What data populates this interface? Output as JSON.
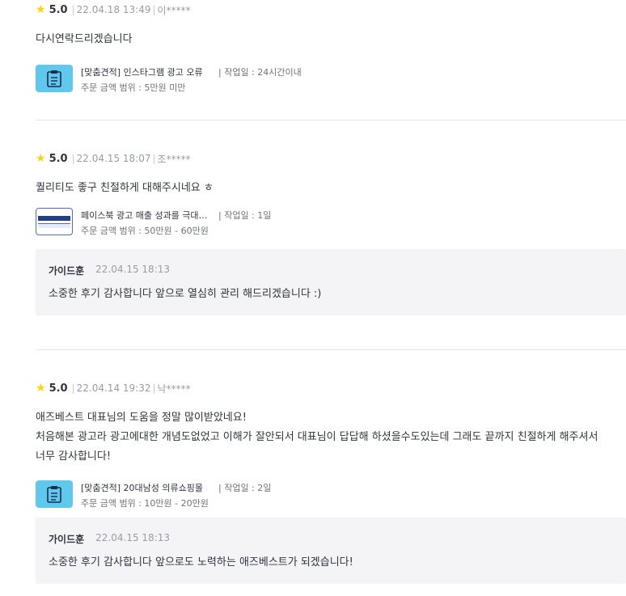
{
  "reviews": [
    {
      "rating": "5.0",
      "date": "22.04.18 13:49",
      "user": "이*****",
      "text": "다시연락드리겠습니다",
      "service_title": "[맞춤견적] 인스타그램 광고 오류",
      "work_time": "| 작업일 : 24시간이내",
      "price_range": "주문 금액 범위 : 5만원 미만",
      "thumb_icon": "clipboard-icon"
    },
    {
      "rating": "5.0",
      "date": "22.04.15 18:07",
      "user": "조*****",
      "text": "퀄리티도 좋구 친절하게 대해주시네요 ㅎ",
      "service_title": "페이스북 광고 매출 성과를 극대…",
      "work_time": "| 작업일 : 1일",
      "price_range": "주문 금액 범위 : 50만원 - 60만원",
      "reply_name": "가이드훈",
      "reply_date": "22.04.15 18:13",
      "reply_text": "소중한 후기 감사합니다 앞으로 열심히 관리 해드리겠습니다 :)"
    },
    {
      "rating": "5.0",
      "date": "22.04.14 19:32",
      "user": "낙*****",
      "text_line1": "애즈베스트 대표님의 도움을 정말 많이받았네요!",
      "text_line2": "처음해본 광고라 광고에대한 개념도없었고 이해가 잘안되서 대표님이 답답해 하셨을수도있는데 그래도 끝까지 친절하게 해주셔서",
      "text_line3": "너무 감사합니다!",
      "service_title": "[맞춤견적] 20대남성 의류쇼핑몰",
      "work_time": "| 작업일 : 2일",
      "price_range": "주문 금액 범위 : 10만원 - 20만원",
      "thumb_icon": "clipboard-icon",
      "reply_name": "가이드훈",
      "reply_date": "22.04.15 18:13",
      "reply_text": "소중한 후기 감사합니다 앞으로도 노력하는 애즈베스트가 되겠습니다!"
    }
  ],
  "colors": {
    "star": "#ffd400",
    "thumb": "#5fc8ec",
    "reply_bg": "#f4f4f6"
  }
}
